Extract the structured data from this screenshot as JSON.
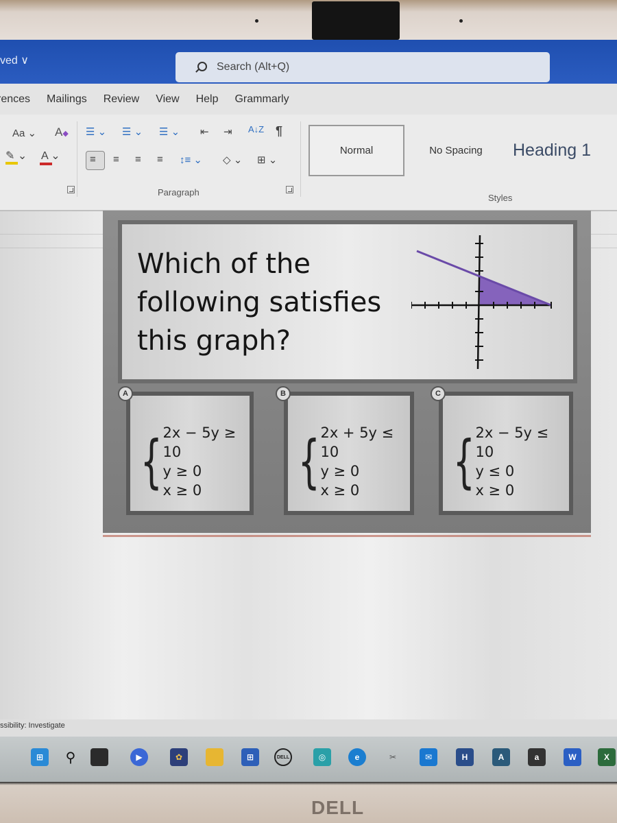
{
  "titlebar": {
    "saved_label": "ved ∨",
    "search_placeholder": "Search (Alt+Q)"
  },
  "tabs": [
    "rences",
    "Mailings",
    "Review",
    "View",
    "Help",
    "Grammarly"
  ],
  "ribbon": {
    "font_group": {
      "change_case": "Aa ⌄",
      "clear_format_icon": "clear-formatting-icon",
      "highlight_icon": "highlighter-icon",
      "font_color_icon": "font-color-icon",
      "font_color_label": "A"
    },
    "paragraph_group": {
      "label": "Paragraph",
      "buttons": [
        "bullets",
        "numbering",
        "multilevel-list",
        "decrease-indent",
        "increase-indent",
        "sort",
        "show-formatting",
        "align-left",
        "center",
        "align-right",
        "justify",
        "line-spacing",
        "shading",
        "borders"
      ],
      "sort_glyph": "A↓Z",
      "pilcrow": "¶"
    },
    "styles_group": {
      "label": "Styles",
      "items": [
        {
          "name": "Normal",
          "selected": true
        },
        {
          "name": "No Spacing",
          "selected": false
        },
        {
          "name": "Heading 1",
          "selected": false
        }
      ]
    }
  },
  "document": {
    "question": {
      "line1": "Which of the",
      "line2": "following satisfies",
      "line3": "this graph?"
    },
    "graph": {
      "description": "Line through (0,2) and (5,0); shaded triangle in first quadrant below the line",
      "shade_color": "#7b55b8",
      "x_ticks": 10,
      "y_ticks": 9
    },
    "answers": [
      {
        "label": "A",
        "eq1": "2x − 5y ≥ 10",
        "eq2": "y ≥ 0",
        "eq3": "x ≥ 0"
      },
      {
        "label": "B",
        "eq1": "2x + 5y ≤ 10",
        "eq2": "y ≥ 0",
        "eq3": "x ≥ 0"
      },
      {
        "label": "C",
        "eq1": "2x − 5y ≤ 10",
        "eq2": "y ≤ 0",
        "eq3": "x ≥ 0"
      }
    ]
  },
  "statusbar": {
    "accessibility": "ssibility: Investigate"
  },
  "taskbar": {
    "icons": [
      "windows-start",
      "search",
      "task-view",
      "meet-chat",
      "photos-app",
      "file-explorer",
      "microsoft-store",
      "dell-app",
      "app-teal",
      "edge",
      "snipping-tool",
      "mail",
      "h-app",
      "a-app",
      "amazon",
      "word",
      "excel"
    ],
    "dell_label": "DELL",
    "amazon_label": "a",
    "word_label": "W",
    "excel_label": "X"
  },
  "hardware": {
    "brand": "DELL"
  }
}
